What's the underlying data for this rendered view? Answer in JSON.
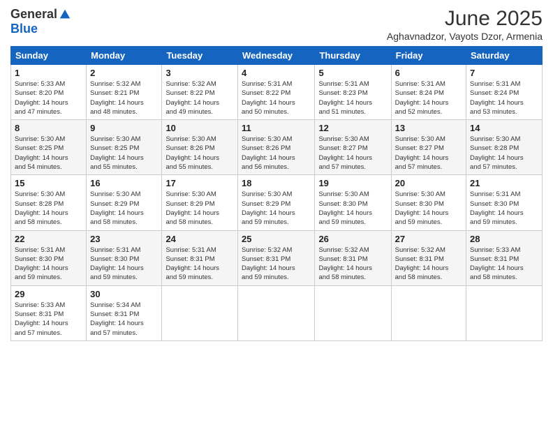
{
  "header": {
    "logo_general": "General",
    "logo_blue": "Blue",
    "month_title": "June 2025",
    "location": "Aghavnadzor, Vayots Dzor, Armenia"
  },
  "weekdays": [
    "Sunday",
    "Monday",
    "Tuesday",
    "Wednesday",
    "Thursday",
    "Friday",
    "Saturday"
  ],
  "weeks": [
    [
      {
        "day": "1",
        "info": "Sunrise: 5:33 AM\nSunset: 8:20 PM\nDaylight: 14 hours\nand 47 minutes."
      },
      {
        "day": "2",
        "info": "Sunrise: 5:32 AM\nSunset: 8:21 PM\nDaylight: 14 hours\nand 48 minutes."
      },
      {
        "day": "3",
        "info": "Sunrise: 5:32 AM\nSunset: 8:22 PM\nDaylight: 14 hours\nand 49 minutes."
      },
      {
        "day": "4",
        "info": "Sunrise: 5:31 AM\nSunset: 8:22 PM\nDaylight: 14 hours\nand 50 minutes."
      },
      {
        "day": "5",
        "info": "Sunrise: 5:31 AM\nSunset: 8:23 PM\nDaylight: 14 hours\nand 51 minutes."
      },
      {
        "day": "6",
        "info": "Sunrise: 5:31 AM\nSunset: 8:24 PM\nDaylight: 14 hours\nand 52 minutes."
      },
      {
        "day": "7",
        "info": "Sunrise: 5:31 AM\nSunset: 8:24 PM\nDaylight: 14 hours\nand 53 minutes."
      }
    ],
    [
      {
        "day": "8",
        "info": "Sunrise: 5:30 AM\nSunset: 8:25 PM\nDaylight: 14 hours\nand 54 minutes."
      },
      {
        "day": "9",
        "info": "Sunrise: 5:30 AM\nSunset: 8:25 PM\nDaylight: 14 hours\nand 55 minutes."
      },
      {
        "day": "10",
        "info": "Sunrise: 5:30 AM\nSunset: 8:26 PM\nDaylight: 14 hours\nand 55 minutes."
      },
      {
        "day": "11",
        "info": "Sunrise: 5:30 AM\nSunset: 8:26 PM\nDaylight: 14 hours\nand 56 minutes."
      },
      {
        "day": "12",
        "info": "Sunrise: 5:30 AM\nSunset: 8:27 PM\nDaylight: 14 hours\nand 57 minutes."
      },
      {
        "day": "13",
        "info": "Sunrise: 5:30 AM\nSunset: 8:27 PM\nDaylight: 14 hours\nand 57 minutes."
      },
      {
        "day": "14",
        "info": "Sunrise: 5:30 AM\nSunset: 8:28 PM\nDaylight: 14 hours\nand 57 minutes."
      }
    ],
    [
      {
        "day": "15",
        "info": "Sunrise: 5:30 AM\nSunset: 8:28 PM\nDaylight: 14 hours\nand 58 minutes."
      },
      {
        "day": "16",
        "info": "Sunrise: 5:30 AM\nSunset: 8:29 PM\nDaylight: 14 hours\nand 58 minutes."
      },
      {
        "day": "17",
        "info": "Sunrise: 5:30 AM\nSunset: 8:29 PM\nDaylight: 14 hours\nand 58 minutes."
      },
      {
        "day": "18",
        "info": "Sunrise: 5:30 AM\nSunset: 8:29 PM\nDaylight: 14 hours\nand 59 minutes."
      },
      {
        "day": "19",
        "info": "Sunrise: 5:30 AM\nSunset: 8:30 PM\nDaylight: 14 hours\nand 59 minutes."
      },
      {
        "day": "20",
        "info": "Sunrise: 5:30 AM\nSunset: 8:30 PM\nDaylight: 14 hours\nand 59 minutes."
      },
      {
        "day": "21",
        "info": "Sunrise: 5:31 AM\nSunset: 8:30 PM\nDaylight: 14 hours\nand 59 minutes."
      }
    ],
    [
      {
        "day": "22",
        "info": "Sunrise: 5:31 AM\nSunset: 8:30 PM\nDaylight: 14 hours\nand 59 minutes."
      },
      {
        "day": "23",
        "info": "Sunrise: 5:31 AM\nSunset: 8:30 PM\nDaylight: 14 hours\nand 59 minutes."
      },
      {
        "day": "24",
        "info": "Sunrise: 5:31 AM\nSunset: 8:31 PM\nDaylight: 14 hours\nand 59 minutes."
      },
      {
        "day": "25",
        "info": "Sunrise: 5:32 AM\nSunset: 8:31 PM\nDaylight: 14 hours\nand 59 minutes."
      },
      {
        "day": "26",
        "info": "Sunrise: 5:32 AM\nSunset: 8:31 PM\nDaylight: 14 hours\nand 58 minutes."
      },
      {
        "day": "27",
        "info": "Sunrise: 5:32 AM\nSunset: 8:31 PM\nDaylight: 14 hours\nand 58 minutes."
      },
      {
        "day": "28",
        "info": "Sunrise: 5:33 AM\nSunset: 8:31 PM\nDaylight: 14 hours\nand 58 minutes."
      }
    ],
    [
      {
        "day": "29",
        "info": "Sunrise: 5:33 AM\nSunset: 8:31 PM\nDaylight: 14 hours\nand 57 minutes."
      },
      {
        "day": "30",
        "info": "Sunrise: 5:34 AM\nSunset: 8:31 PM\nDaylight: 14 hours\nand 57 minutes."
      },
      null,
      null,
      null,
      null,
      null
    ]
  ]
}
